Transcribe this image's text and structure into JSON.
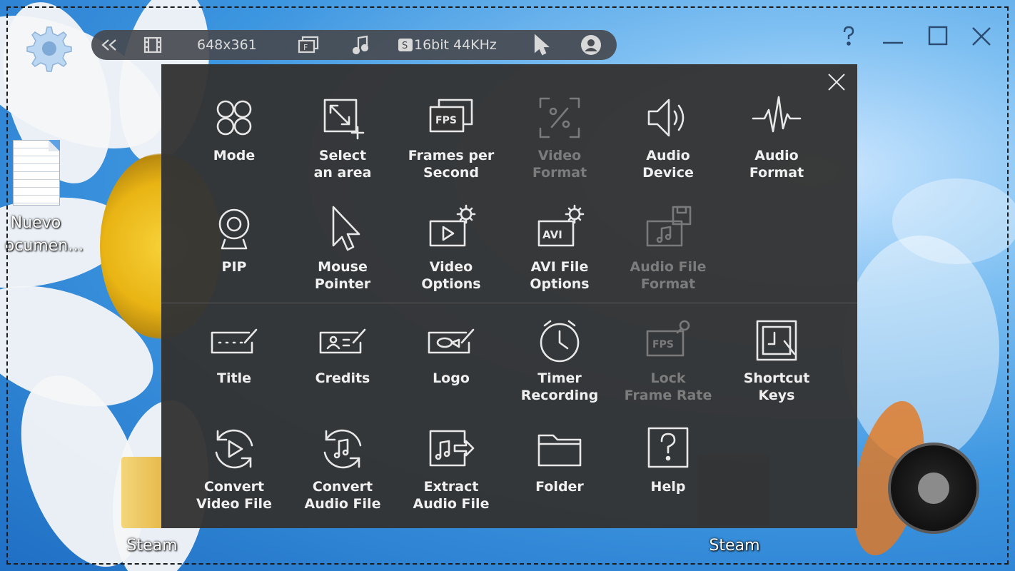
{
  "toolbar": {
    "resolution": "648x361",
    "audio_info": "16bit 44KHz",
    "s_badge": "S",
    "f_badge": "F"
  },
  "desktop": {
    "doc_label_1": "Nuevo",
    "doc_label_2": "ocumen…",
    "folder_label": "Steam",
    "steam_label": "Steam"
  },
  "panel": {
    "items": [
      {
        "label": "Mode",
        "icon": "mode-icon",
        "enabled": true
      },
      {
        "label": "Select\nan area",
        "icon": "select-area-icon",
        "enabled": true
      },
      {
        "label": "Frames per\nSecond",
        "icon": "fps-icon",
        "enabled": true
      },
      {
        "label": "Video\nFormat",
        "icon": "video-format-icon",
        "enabled": false
      },
      {
        "label": "Audio\nDevice",
        "icon": "speaker-icon",
        "enabled": true
      },
      {
        "label": "Audio\nFormat",
        "icon": "waveform-icon",
        "enabled": true
      },
      {
        "label": "PIP",
        "icon": "webcam-icon",
        "enabled": true
      },
      {
        "label": "Mouse\nPointer",
        "icon": "pointer-icon",
        "enabled": true
      },
      {
        "label": "Video\nOptions",
        "icon": "video-options-icon",
        "enabled": true
      },
      {
        "label": "AVI File\nOptions",
        "icon": "avi-icon",
        "enabled": true
      },
      {
        "label": "Audio File\nFormat",
        "icon": "audio-file-format-icon",
        "enabled": false
      },
      {
        "label": "Title",
        "icon": "title-icon",
        "enabled": true
      },
      {
        "label": "Credits",
        "icon": "credits-icon",
        "enabled": true
      },
      {
        "label": "Logo",
        "icon": "logo-icon",
        "enabled": true
      },
      {
        "label": "Timer\nRecording",
        "icon": "clock-icon",
        "enabled": true
      },
      {
        "label": "Lock\nFrame Rate",
        "icon": "lock-fps-icon",
        "enabled": false
      },
      {
        "label": "Shortcut\nKeys",
        "icon": "shortcut-icon",
        "enabled": true
      },
      {
        "label": "Convert\nVideo File",
        "icon": "convert-video-icon",
        "enabled": true
      },
      {
        "label": "Convert\nAudio File",
        "icon": "convert-audio-icon",
        "enabled": true
      },
      {
        "label": "Extract\nAudio File",
        "icon": "extract-audio-icon",
        "enabled": true
      },
      {
        "label": "Folder",
        "icon": "folder-icon",
        "enabled": true
      },
      {
        "label": "Help",
        "icon": "help-icon",
        "enabled": true
      }
    ]
  }
}
